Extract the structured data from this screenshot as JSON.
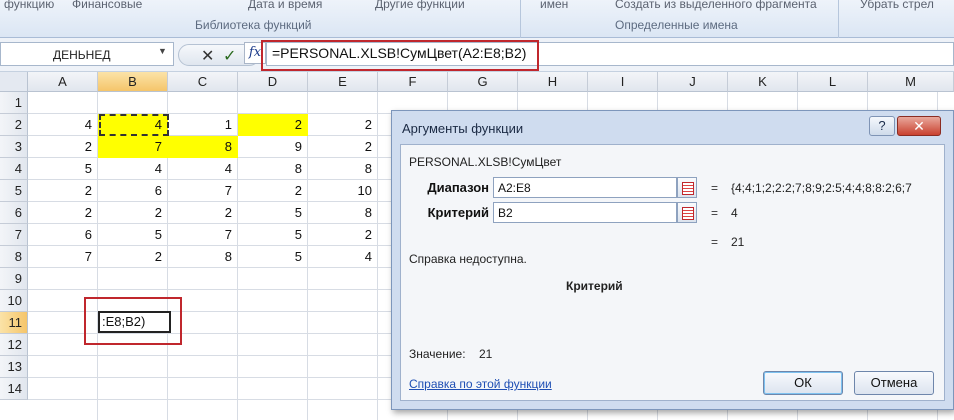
{
  "ribbon": {
    "items": [
      "функцию",
      "Финансовые",
      "Дата и время",
      "Другие функции",
      "имен",
      "Создать из выделенного фрагмента",
      "Убрать стрел"
    ],
    "groups": [
      "Библиотека функций",
      "Определенные имена"
    ]
  },
  "formula_bar": {
    "name_box": "ДЕНЬНЕД",
    "cancel": "✕",
    "enter": "✓",
    "fx": "fx",
    "formula": "=PERSONAL.XLSB!СумЦвет(A2:E8;B2)"
  },
  "columns": [
    "A",
    "B",
    "C",
    "D",
    "E",
    "F",
    "G",
    "H",
    "I",
    "J",
    "K",
    "L",
    "M"
  ],
  "rows": [
    "1",
    "2",
    "3",
    "4",
    "5",
    "6",
    "7",
    "8",
    "9",
    "10",
    "11",
    "12",
    "13",
    "14"
  ],
  "cells": [
    [
      "",
      "",
      "",
      "",
      ""
    ],
    [
      "4",
      "4",
      "1",
      "2",
      "2"
    ],
    [
      "2",
      "7",
      "8",
      "9",
      "2"
    ],
    [
      "5",
      "4",
      "4",
      "8",
      "8"
    ],
    [
      "2",
      "6",
      "7",
      "2",
      "10"
    ],
    [
      "2",
      "2",
      "2",
      "5",
      "8"
    ],
    [
      "6",
      "5",
      "7",
      "5",
      "2"
    ],
    [
      "7",
      "2",
      "8",
      "5",
      "4"
    ]
  ],
  "highlight_color": "#ffff00",
  "edit_cell_text": "E8;B2)",
  "edit_cell_prefix": ":",
  "dialog": {
    "title": "Аргументы функции",
    "help_btn": "?",
    "close_btn": "✕",
    "function_name": "PERSONAL.XLSB!СумЦвет",
    "args": [
      {
        "label": "Диапазон",
        "value": "A2:E8",
        "result": "{4;4;1;2;2:2;7;8;9;2:5;4;4;8;8:2;6;7"
      },
      {
        "label": "Критерий",
        "value": "B2",
        "result": "4"
      }
    ],
    "eq": "=",
    "function_result": "21",
    "help_unavailable": "Справка недоступна.",
    "arg_description_title": "Критерий",
    "value_label": "Значение:",
    "value": "21",
    "help_link": "Справка по этой функции",
    "ok": "ОК",
    "cancel": "Отмена"
  }
}
